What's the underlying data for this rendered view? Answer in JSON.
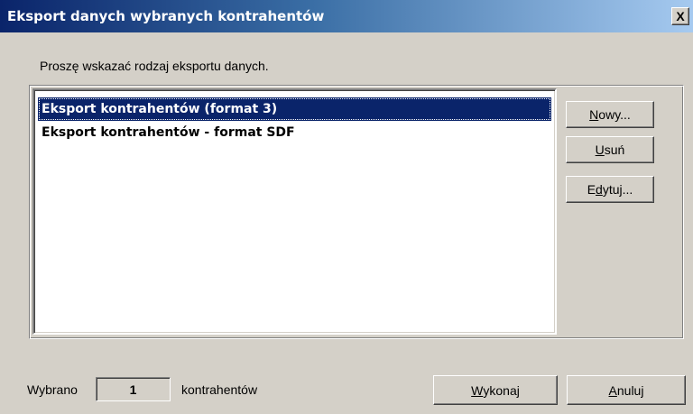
{
  "window": {
    "title": "Eksport danych wybranych kontrahentów",
    "close_label": "X"
  },
  "instruction": "Proszę wskazać rodzaj eksportu danych.",
  "export_list": {
    "items": [
      {
        "label": "Eksport kontrahentów (format 3)",
        "selected": true
      },
      {
        "label": "Eksport kontrahentów - format SDF",
        "selected": false
      }
    ]
  },
  "buttons": {
    "nowy": {
      "mnemonic": "N",
      "rest": "owy..."
    },
    "usun": {
      "mnemonic": "U",
      "rest": "suń"
    },
    "edytuj": {
      "pre": "E",
      "mnemonic": "d",
      "rest": "ytuj..."
    },
    "wykonaj": {
      "mnemonic": "W",
      "rest": "ykonaj"
    },
    "anuluj": {
      "mnemonic": "A",
      "rest": "nuluj"
    }
  },
  "footer": {
    "selected_prefix": "Wybrano",
    "selected_count": "1",
    "selected_suffix": "kontrahentów"
  },
  "colors": {
    "title_gradient_start": "#0a246a",
    "title_gradient_end": "#a6caf0",
    "selection": "#0a246a",
    "face": "#d4d0c8"
  }
}
